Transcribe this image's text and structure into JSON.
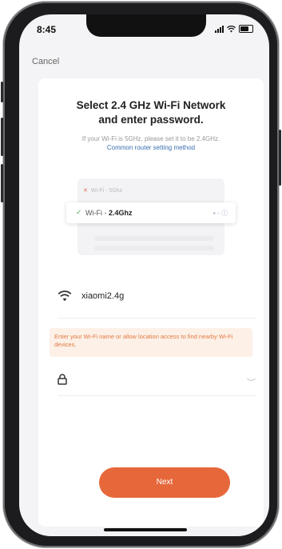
{
  "status_bar": {
    "time": "8:45"
  },
  "nav": {
    "cancel_label": "Cancel"
  },
  "main": {
    "title_line1": "Select 2.4 GHz Wi-Fi Network",
    "title_line2": "and enter password.",
    "subtitle": "If your Wi-Fi is 5GHz, please set it to be 2.4GHz.",
    "subtitle_link": "Common router setting method"
  },
  "illustration": {
    "row_5ghz": "Wi-Fi - 5Ghz",
    "row_24_prefix": "Wi-Fi - ",
    "row_24_band": "2.4Ghz"
  },
  "form": {
    "wifi_name": "xiaomi2.4g",
    "warning": "Enter your Wi-Fi name or allow location access to find nearby Wi-Fi devices.",
    "password_value": ""
  },
  "actions": {
    "next_label": "Next"
  },
  "colors": {
    "accent": "#e6683a",
    "link": "#3a6fb0",
    "warning_text": "#e07a40",
    "warning_bg": "#fdf0e7"
  },
  "icons": [
    "wifi-icon",
    "lock-icon",
    "eye-closed-icon",
    "check-icon",
    "close-icon"
  ]
}
